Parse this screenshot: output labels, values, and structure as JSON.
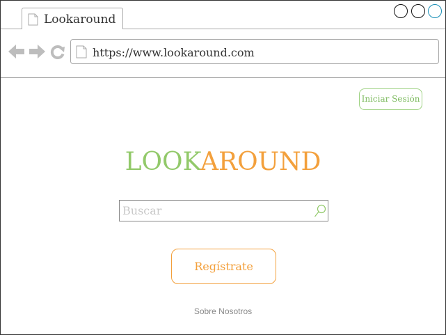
{
  "browser": {
    "tab_title": "Lookaround",
    "url": "https://www.lookaround.com"
  },
  "page": {
    "login_label": "Iniciar Sesión",
    "logo_part1": "LOOK",
    "logo_part2": "AROUND",
    "search_placeholder": "Buscar",
    "register_label": "Regístrate",
    "about_link": "Sobre Nosotros"
  },
  "icons": {
    "tab": "document-icon",
    "back": "back-arrow-icon",
    "forward": "forward-arrow-icon",
    "reload": "reload-icon",
    "url": "document-icon",
    "search": "search-icon"
  },
  "colors": {
    "logo_green": "#92c96a",
    "logo_orange": "#f3a03c",
    "login_green": "#7cba5e",
    "register_orange": "#f3a03c"
  }
}
